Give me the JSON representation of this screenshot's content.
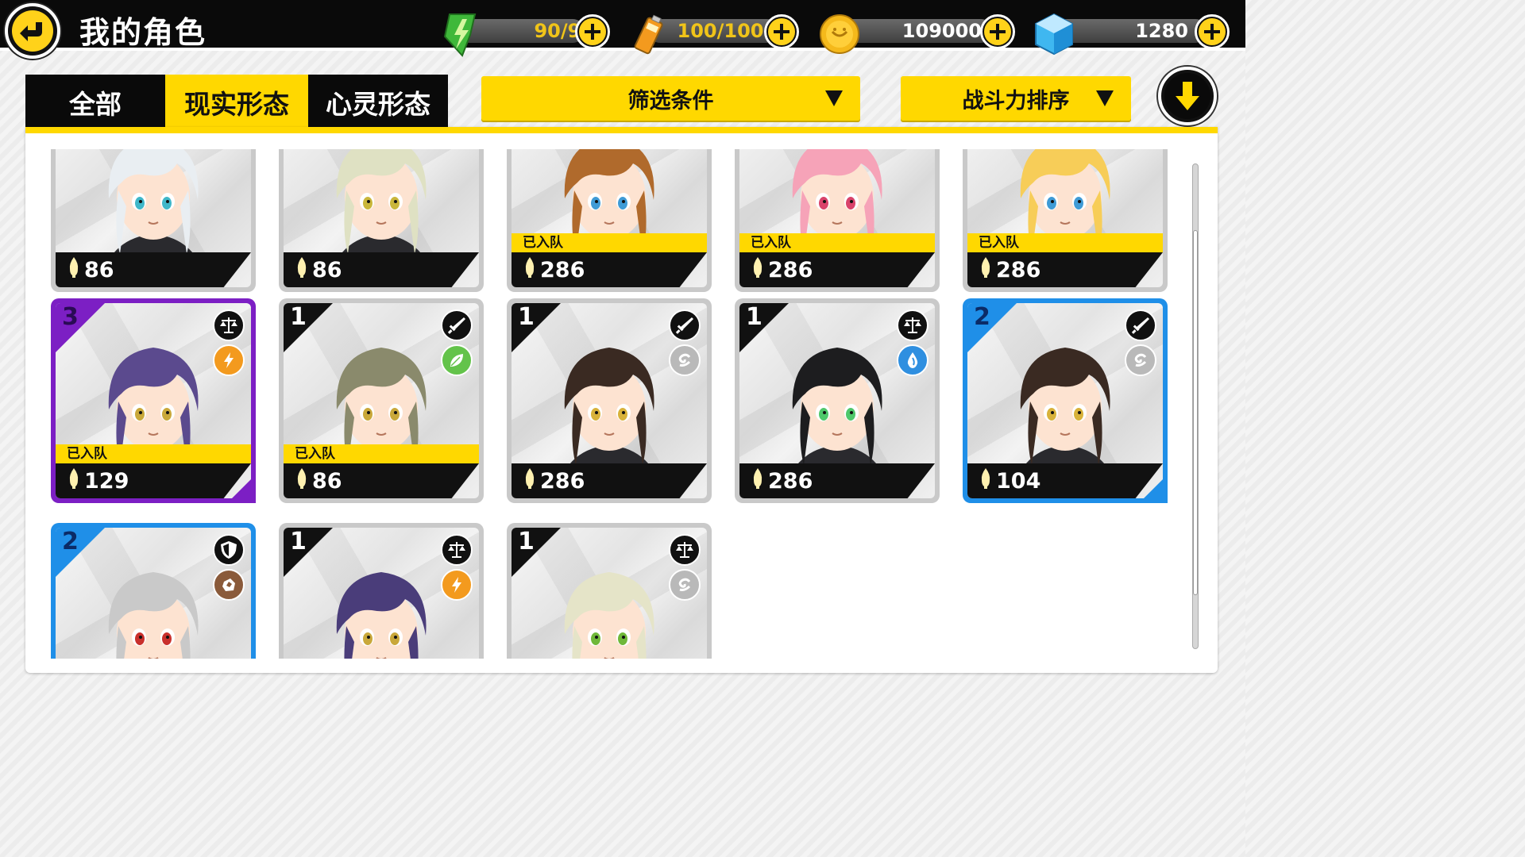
{
  "header": {
    "title": "我的角色",
    "resources": [
      {
        "name": "stamina",
        "value": "90/90",
        "color": "#f0c419",
        "icon": "lightning-gem-icon"
      },
      {
        "name": "battery",
        "value": "100/100",
        "color": "#f0c419",
        "icon": "battery-icon"
      },
      {
        "name": "coins",
        "value": "109000",
        "color": "#ffffff",
        "icon": "coin-icon"
      },
      {
        "name": "gems",
        "value": "1280",
        "color": "#ffffff",
        "icon": "diamond-icon"
      }
    ]
  },
  "tabs": [
    {
      "label": "全部",
      "active": false
    },
    {
      "label": "现实形态",
      "active": true
    },
    {
      "label": "心灵形态",
      "active": false
    }
  ],
  "filter": {
    "label": "筛选条件"
  },
  "sort": {
    "label": "战斗力排序"
  },
  "colors": {
    "accent": "#ffd800",
    "purple": "#7c1fc4",
    "blue": "#1f8fe8",
    "dark": "#111111"
  },
  "cards": [
    {
      "power": "86",
      "team": "",
      "level": "",
      "rarity": "gray",
      "hair": "#e9eef2",
      "eyes": "#3fb7c9"
    },
    {
      "power": "86",
      "team": "",
      "level": "",
      "rarity": "gray",
      "hair": "#dfe1c3",
      "eyes": "#c9b63a"
    },
    {
      "power": "286",
      "team": "已入队",
      "level": "",
      "rarity": "gray",
      "hair": "#b06a2c",
      "eyes": "#3f9bd6"
    },
    {
      "power": "286",
      "team": "已入队",
      "level": "",
      "rarity": "gray",
      "hair": "#f6a3b8",
      "eyes": "#d9436b"
    },
    {
      "power": "286",
      "team": "已入队",
      "level": "",
      "rarity": "gray",
      "hair": "#f7cd58",
      "eyes": "#3f9bd6"
    },
    {
      "power": "129",
      "team": "已入队",
      "level": "3",
      "rarity": "purple",
      "hair": "#5b4a8e",
      "eyes": "#c9a83a",
      "type_icon": "scales-icon",
      "element_icon": "lightning-icon",
      "element_color": "#f39a1e"
    },
    {
      "power": "86",
      "team": "已入队",
      "level": "1",
      "rarity": "gray",
      "hair": "#8a8a6c",
      "eyes": "#c9a83a",
      "type_icon": "sword-icon",
      "element_icon": "leaf-icon",
      "element_color": "#63c34a"
    },
    {
      "power": "286",
      "team": "",
      "level": "1",
      "rarity": "gray",
      "hair": "#3a2a22",
      "eyes": "#d8b23a",
      "type_icon": "sword-icon",
      "element_icon": "wind-icon",
      "element_color": "#b9b9b9"
    },
    {
      "power": "286",
      "team": "",
      "level": "1",
      "rarity": "gray",
      "hair": "#1d1d1f",
      "eyes": "#4fc86b",
      "type_icon": "scales-icon",
      "element_icon": "water-drop-icon",
      "element_color": "#2f8fe0"
    },
    {
      "power": "104",
      "team": "",
      "level": "2",
      "rarity": "blue",
      "hair": "#3a2a22",
      "eyes": "#d8b23a",
      "type_icon": "sword-icon",
      "element_icon": "wind-icon",
      "element_color": "#b9b9b9"
    },
    {
      "power": "",
      "team": "",
      "level": "2",
      "rarity": "blue",
      "hair": "#c9c9c9",
      "eyes": "#c9302c",
      "type_icon": "shield-icon",
      "element_icon": "rock-icon",
      "element_color": "#8a5a3a"
    },
    {
      "power": "",
      "team": "",
      "level": "1",
      "rarity": "gray",
      "hair": "#4a3d7a",
      "eyes": "#c9a83a",
      "type_icon": "scales-icon",
      "element_icon": "lightning-icon",
      "element_color": "#f39a1e"
    },
    {
      "power": "",
      "team": "",
      "level": "1",
      "rarity": "gray",
      "hair": "#e5e4c8",
      "eyes": "#6fb83a",
      "type_icon": "scales-icon",
      "element_icon": "wind-icon",
      "element_color": "#b9b9b9"
    }
  ]
}
